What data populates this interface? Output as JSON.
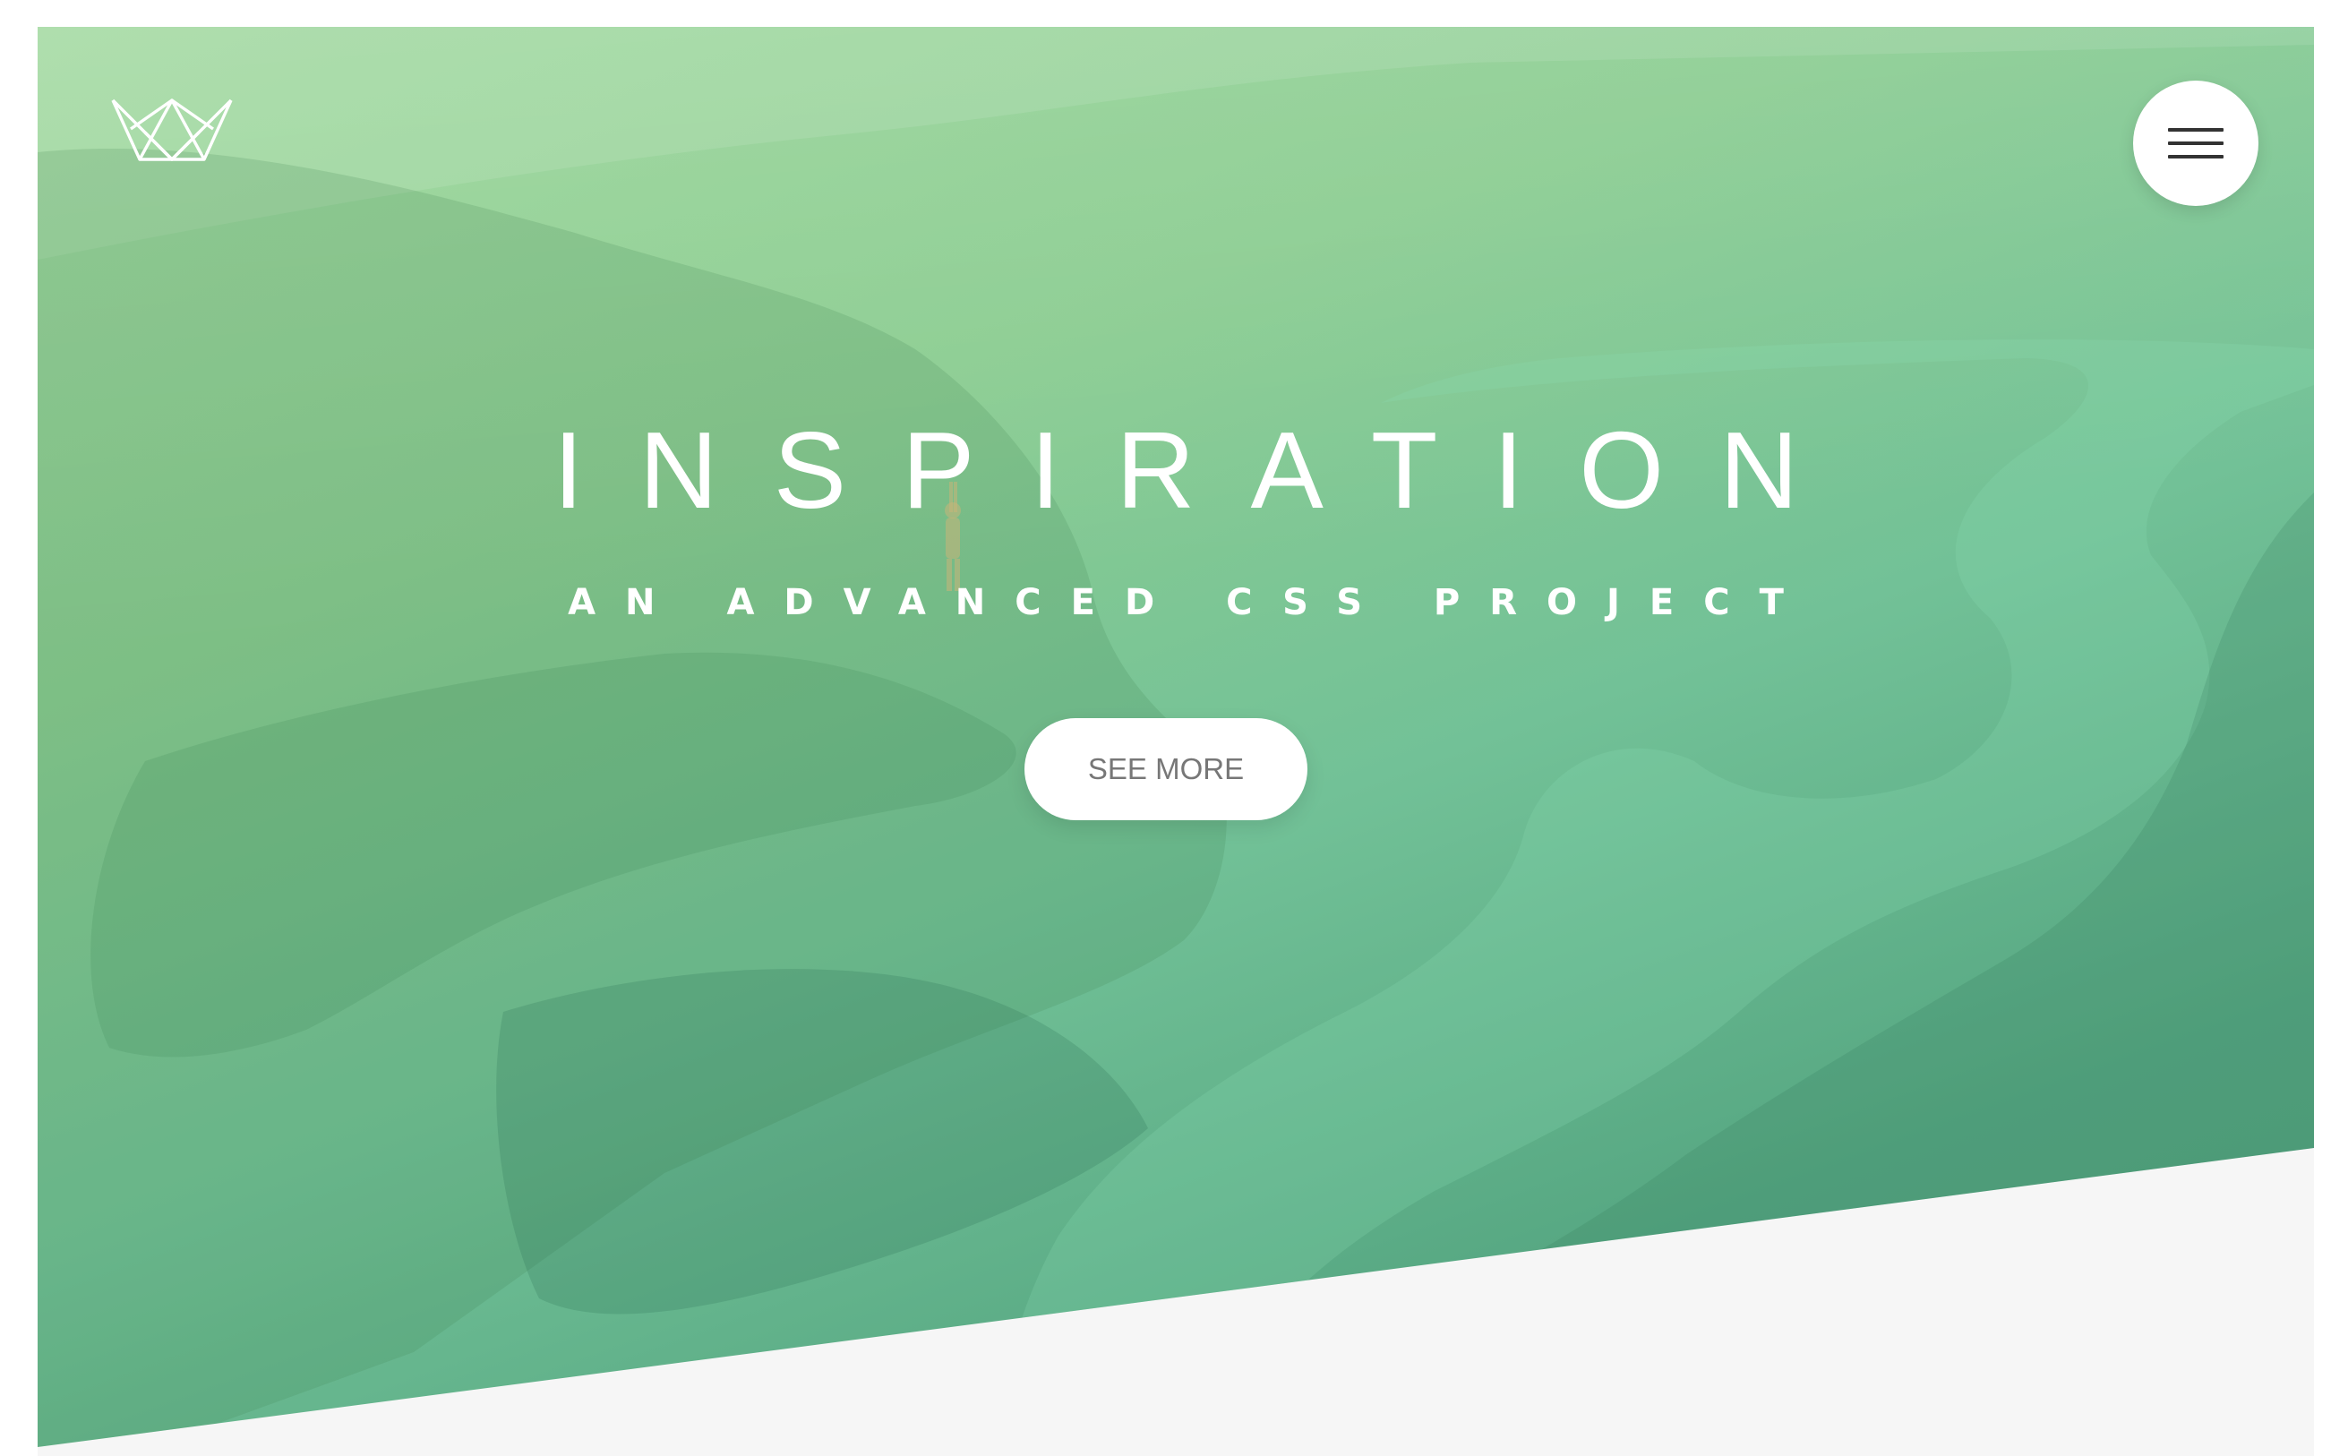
{
  "header": {
    "logo_icon": "crown-logo-icon",
    "menu_icon": "hamburger-menu-icon"
  },
  "hero": {
    "title": "INSPIRATION",
    "subtitle": "AN ADVANCED CSS PROJECT",
    "cta_label": "SEE MORE",
    "overlay_colors": [
      "#9cd79a",
      "#72c197",
      "#4f9d7c"
    ]
  },
  "page": {
    "background_color": "#f6f6f6"
  }
}
